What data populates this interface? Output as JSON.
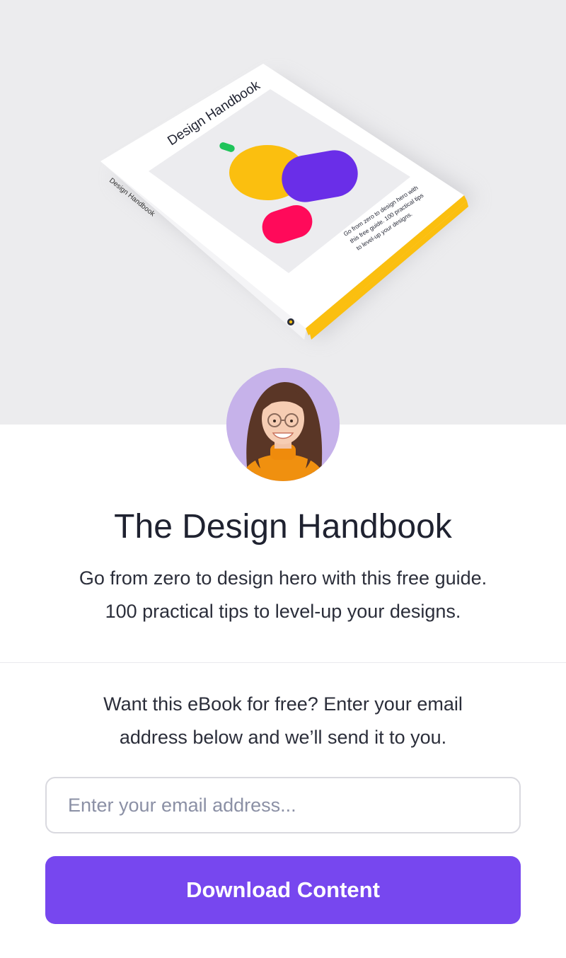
{
  "hero": {
    "book": {
      "cover_title": "Design Handbook",
      "spine_title": "Design Handbook",
      "cover_blurb": [
        "Go from zero to design hero with",
        "this free guide. 100 practical tips",
        "to level-up your designs."
      ]
    }
  },
  "author": {
    "avatar_icon": "person-avatar"
  },
  "main": {
    "title": "The Design Handbook",
    "subtitle_line1": "Go from zero to design hero with this free guide.",
    "subtitle_line2": "100 practical tips to level-up your designs."
  },
  "signup": {
    "prompt_line1": "Want this eBook for free? Enter your email",
    "prompt_line2": "address below and we’ll send it to you.",
    "email_value": "",
    "email_placeholder": "Enter your email address...",
    "button_label": "Download Content"
  },
  "colors": {
    "accent": "#7747ef",
    "hero_bg": "#ececee",
    "book_yellow": "#fbbf0f",
    "book_purple": "#6a2ee8",
    "book_pink": "#ff0a5a",
    "book_green": "#1fc45a"
  }
}
